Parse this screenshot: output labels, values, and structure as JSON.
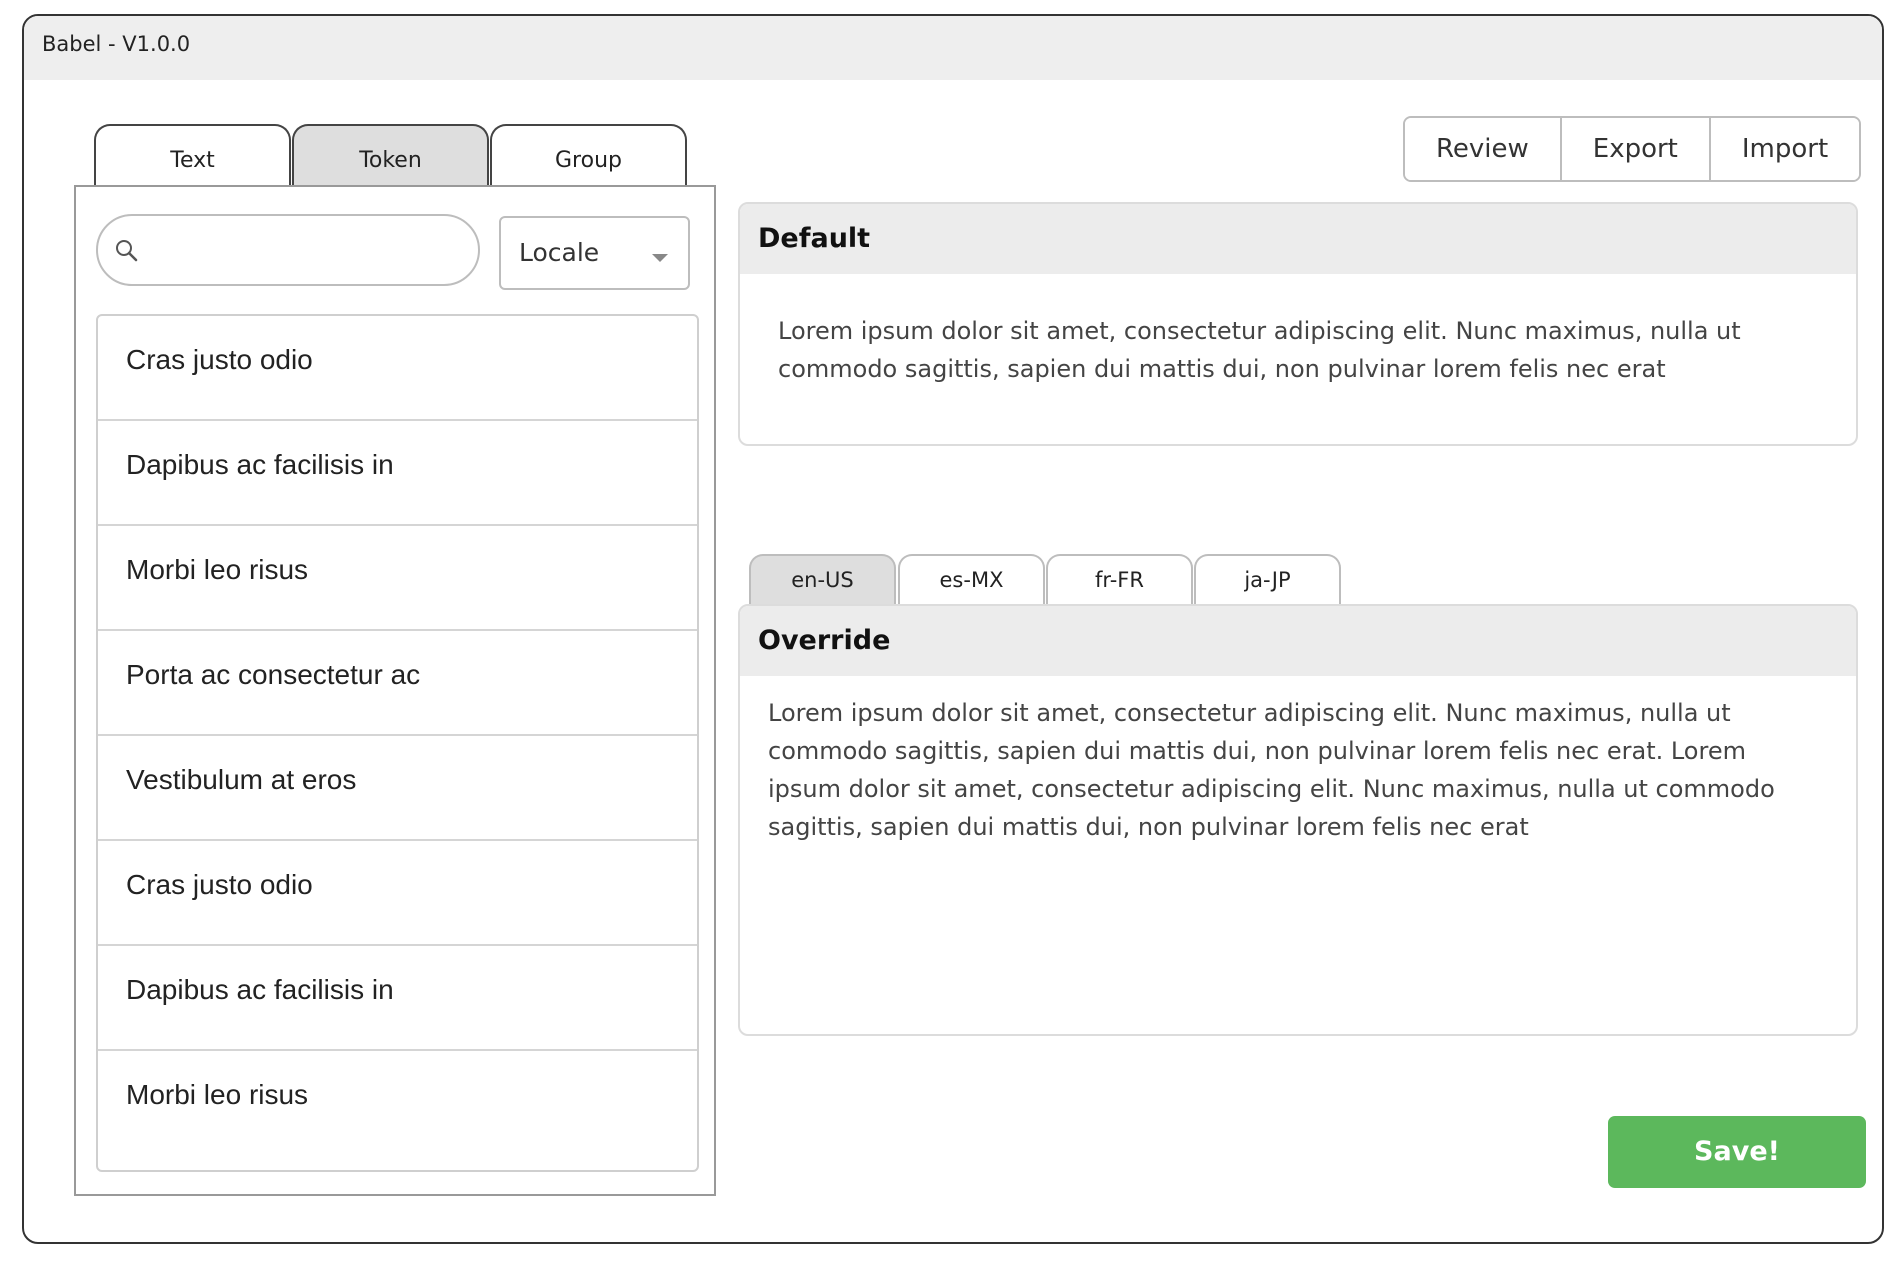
{
  "window": {
    "title": "Babel - V1.0.0"
  },
  "left_tabs": [
    {
      "label": "Text",
      "active": false
    },
    {
      "label": "Token",
      "active": true
    },
    {
      "label": "Group",
      "active": false
    }
  ],
  "search": {
    "value": "",
    "placeholder": "",
    "icon": "search-icon"
  },
  "locale_select": {
    "selected": "Locale",
    "icon": "chevron-down-icon"
  },
  "list_items": [
    "Cras justo odio",
    "Dapibus ac facilisis in",
    "Morbi leo risus",
    "Porta ac consectetur ac",
    "Vestibulum at eros",
    "Cras justo odio",
    "Dapibus ac facilisis in",
    "Morbi leo risus"
  ],
  "toolbar": {
    "review": "Review",
    "export": "Export",
    "import": "Import"
  },
  "default_card": {
    "title": "Default",
    "text": "Lorem ipsum dolor sit amet, consectetur adipiscing elit. Nunc maximus, nulla ut commodo sagittis, sapien dui mattis dui, non pulvinar lorem felis nec erat"
  },
  "locale_tabs": [
    {
      "label": "en-US",
      "active": true
    },
    {
      "label": "es-MX",
      "active": false
    },
    {
      "label": "fr-FR",
      "active": false
    },
    {
      "label": "ja-JP",
      "active": false
    }
  ],
  "override_card": {
    "title": "Override",
    "text": "Lorem ipsum dolor sit amet, consectetur adipiscing elit. Nunc maximus, nulla ut commodo sagittis, sapien dui mattis dui, non pulvinar lorem felis nec erat. Lorem ipsum dolor sit amet, consectetur adipiscing elit. Nunc maximus, nulla ut commodo sagittis, sapien dui mattis dui, non pulvinar lorem felis nec erat"
  },
  "save_label": "Save!",
  "colors": {
    "accent_green": "#5cb85c",
    "header_gray": "#ececec",
    "active_tab": "#dedede"
  }
}
